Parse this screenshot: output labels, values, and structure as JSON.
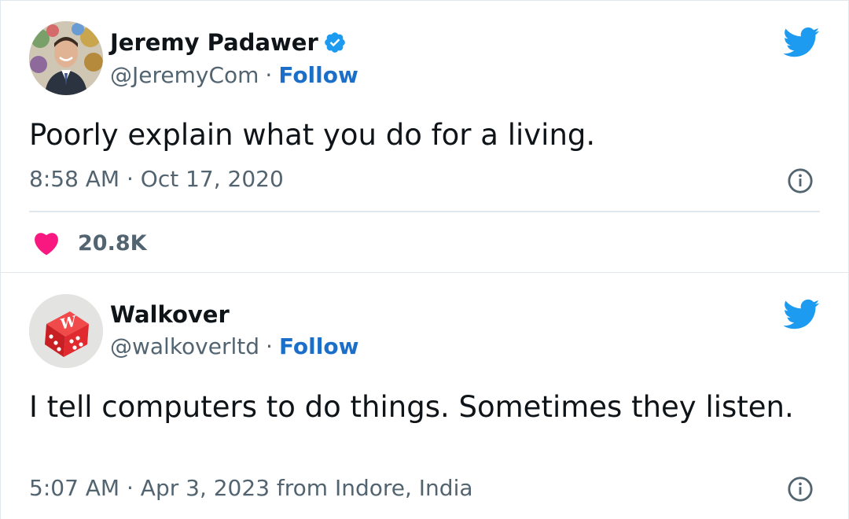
{
  "tweets": [
    {
      "name": "Jeremy Padawer",
      "verified": true,
      "handle": "@JeremyCom",
      "separator": "·",
      "follow_label": "Follow",
      "text": "Poorly explain what you do for a living.",
      "meta": "8:58 AM · Oct 17, 2020",
      "likes": "20.8K"
    },
    {
      "name": "Walkover",
      "verified": false,
      "handle": "@walkoverltd",
      "separator": "·",
      "follow_label": "Follow",
      "text": "I tell computers to do things. Sometimes they listen.",
      "meta": "5:07 AM · Apr 3, 2023 from Indore, India"
    }
  ],
  "colors": {
    "twitter_blue": "#1d9bf0",
    "follow_blue": "#1b6fc9",
    "heart_pink": "#f91880",
    "muted_text": "#536471"
  },
  "icons": [
    "twitter-bird-icon",
    "verified-badge-icon",
    "info-icon",
    "heart-icon"
  ]
}
